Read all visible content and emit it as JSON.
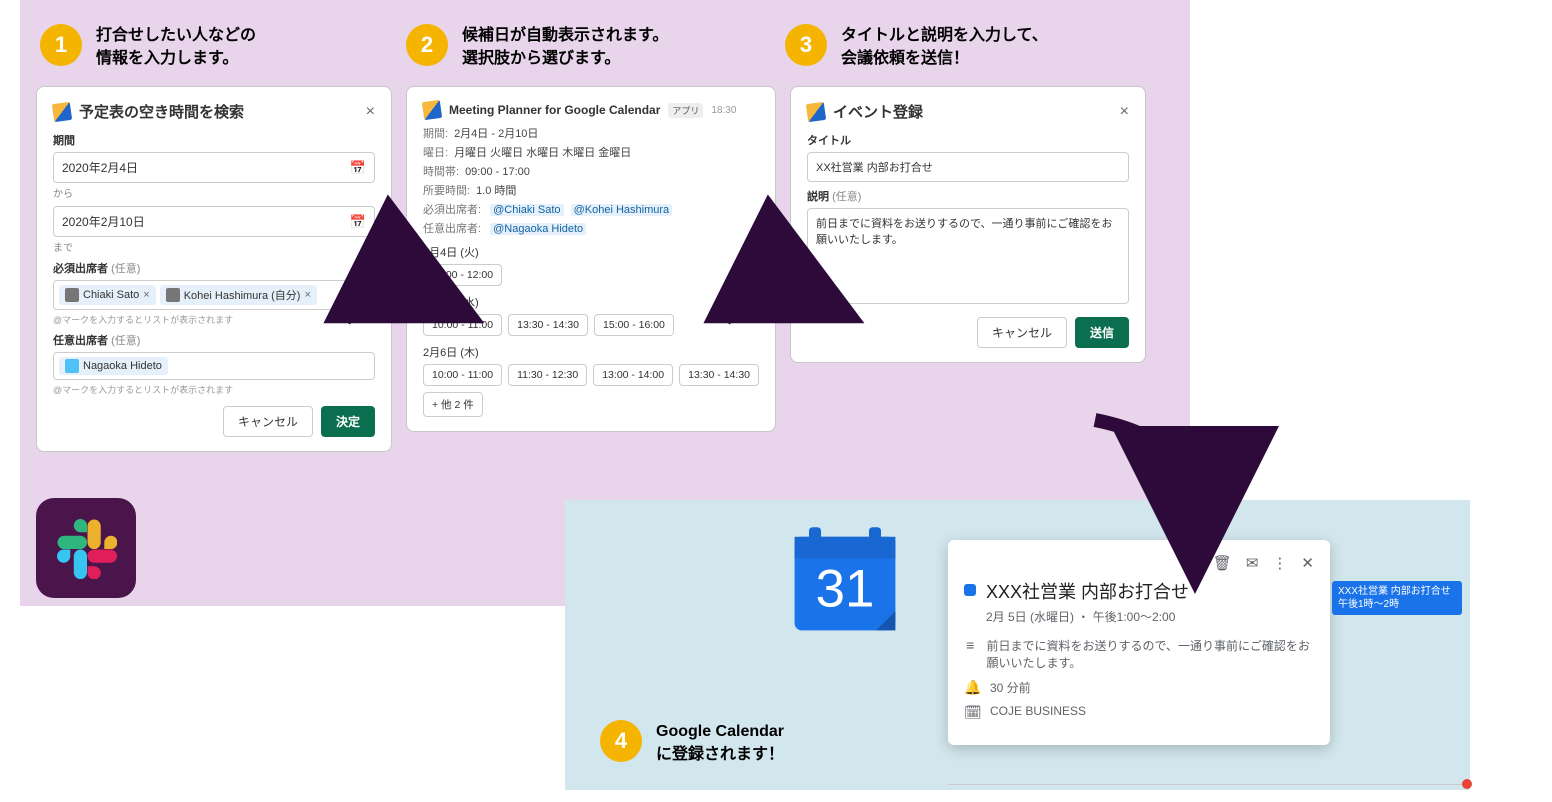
{
  "step1": {
    "num": "1",
    "heading": "打合せしたい人などの\n情報を入力します。",
    "card": {
      "title": "予定表の空き時間を検索",
      "period_label": "期間",
      "date_from": "2020年2月4日",
      "from_suffix": "から",
      "date_to": "2020年2月10日",
      "to_suffix": "まで",
      "required_label": "必須出席者",
      "optional_tag": "(任意)",
      "chip1": "Chiaki Sato",
      "chip2": "Kohei Hashimura (自分)",
      "hint": "@マークを入力するとリストが表示されます",
      "optional_label": "任意出席者",
      "chip3": "Nagaoka Hideto",
      "cancel": "キャンセル",
      "ok": "決定"
    }
  },
  "step2": {
    "num": "2",
    "heading": "候補日が自動表示されます。\n選択肢から選びます。",
    "card": {
      "app_name": "Meeting Planner for Google Calendar",
      "app_tag": "アプリ",
      "time": "18:30",
      "kv_period_k": "期間:",
      "kv_period_v": "2月4日 - 2月10日",
      "kv_days_k": "曜日:",
      "kv_days_v": "月曜日 火曜日 水曜日 木曜日 金曜日",
      "kv_hours_k": "時間帯:",
      "kv_hours_v": "09:00 - 17:00",
      "kv_dur_k": "所要時間:",
      "kv_dur_v": "1.0 時間",
      "kv_req_k": "必須出席者:",
      "req1": "@Chiaki Sato",
      "req2": "@Kohei Hashimura",
      "kv_opt_k": "任意出席者:",
      "opt1": "@Nagaoka Hideto",
      "day1": "2月4日 (火)",
      "day1_slots": [
        "11:00 - 12:00"
      ],
      "day2": "2月5日 (水)",
      "day2_slots": [
        "10:00 - 11:00",
        "13:30 - 14:30",
        "15:00 - 16:00"
      ],
      "day3": "2月6日 (木)",
      "day3_slots": [
        "10:00 - 11:00",
        "11:30 - 12:30",
        "13:00 - 14:00",
        "13:30 - 14:30"
      ],
      "more": "+ 他 2 件"
    }
  },
  "step3": {
    "num": "3",
    "heading": "タイトルと説明を入力して、\n会議依頼を送信！",
    "card": {
      "title": "イベント登録",
      "title_label": "タイトル",
      "title_value": "XX社営業 内部お打合せ",
      "desc_label": "説明",
      "optional_tag": "(任意)",
      "desc_value": "前日までに資料をお送りするので、一通り事前にご確認をお願いいたします。",
      "cancel": "キャンセル",
      "send": "送信"
    }
  },
  "step4": {
    "num": "4",
    "heading": "Google Calendar\nに登録されます！",
    "gcal_day": "31",
    "event": {
      "title": "XXX社営業 内部お打合せ",
      "subtitle": "2月 5日 (水曜日) ・ 午後1:00～2:00",
      "desc": "前日までに資料をお送りするので、一通り事前にご確認をお願いいたします。",
      "reminder": "30 分前",
      "calendar": "COJE BUSINESS"
    },
    "chip": {
      "l1": "XXX社営業 内部お打合せ",
      "l2": "午後1時～2時"
    }
  }
}
